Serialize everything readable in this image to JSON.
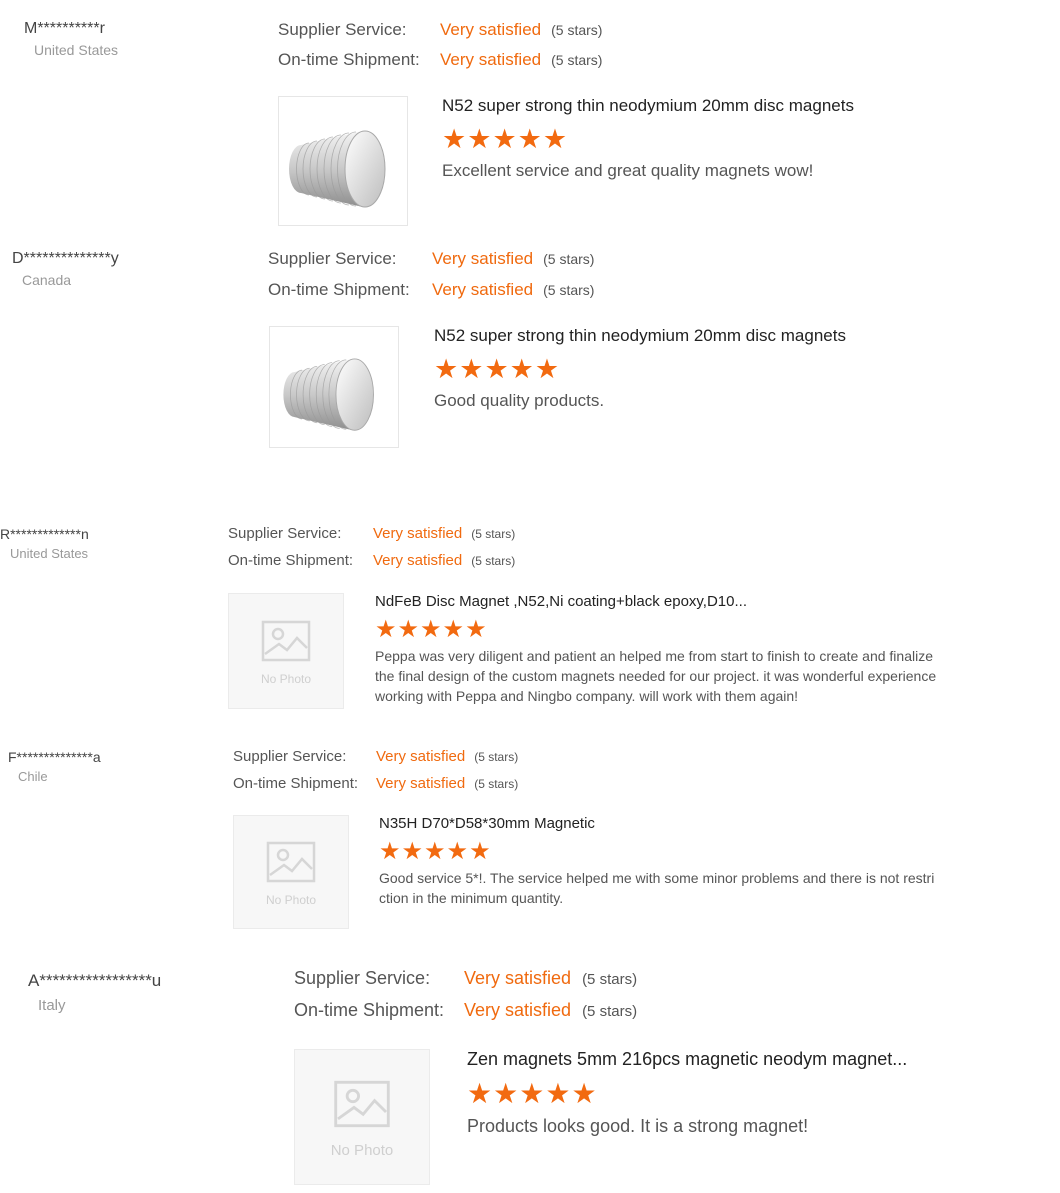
{
  "labels": {
    "supplier_service": "Supplier Service:",
    "ontime_shipment": "On-time Shipment:",
    "very_satisfied": "Very satisfied",
    "five_stars": "(5 stars)",
    "no_photo": "No Photo"
  },
  "colors": {
    "accent": "#f06a0f",
    "star": "#f26a10"
  },
  "reviews": [
    {
      "buyer": "M**********r",
      "country": "United States",
      "product_title": "N52 super strong thin neodymium 20mm disc magnets",
      "rating": 5,
      "photo": "magnet-stack",
      "comment": "Excellent service and great quality magnets wow!"
    },
    {
      "buyer": "D**************y",
      "country": "Canada",
      "product_title": "N52 super strong thin neodymium 20mm disc magnets",
      "rating": 5,
      "photo": "magnet-stack",
      "comment": "Good quality products."
    },
    {
      "buyer": "R*************n",
      "country": "United States",
      "product_title": "NdFeB Disc Magnet ,N52,Ni coating+black epoxy,D10...",
      "rating": 5,
      "photo": "no-photo",
      "comment": "Peppa was very diligent and patient an helped me from start to finish to create and finalize the final design of the custom magnets needed for our  project. it was wonderful experience working with Peppa and Ningbo company. will work with them again!"
    },
    {
      "buyer": "F**************a",
      "country": "Chile",
      "product_title": "N35H D70*D58*30mm Magnetic",
      "rating": 5,
      "photo": "no-photo",
      "comment": "Good service 5*!. The service helped me with some minor problems and there is not restriction in the minimum quantity."
    },
    {
      "buyer": "A*****************u",
      "country": "Italy",
      "product_title": "Zen magnets 5mm 216pcs magnetic neodym magnet...",
      "rating": 5,
      "photo": "no-photo",
      "comment": "Products looks good. It is a strong magnet!"
    }
  ]
}
